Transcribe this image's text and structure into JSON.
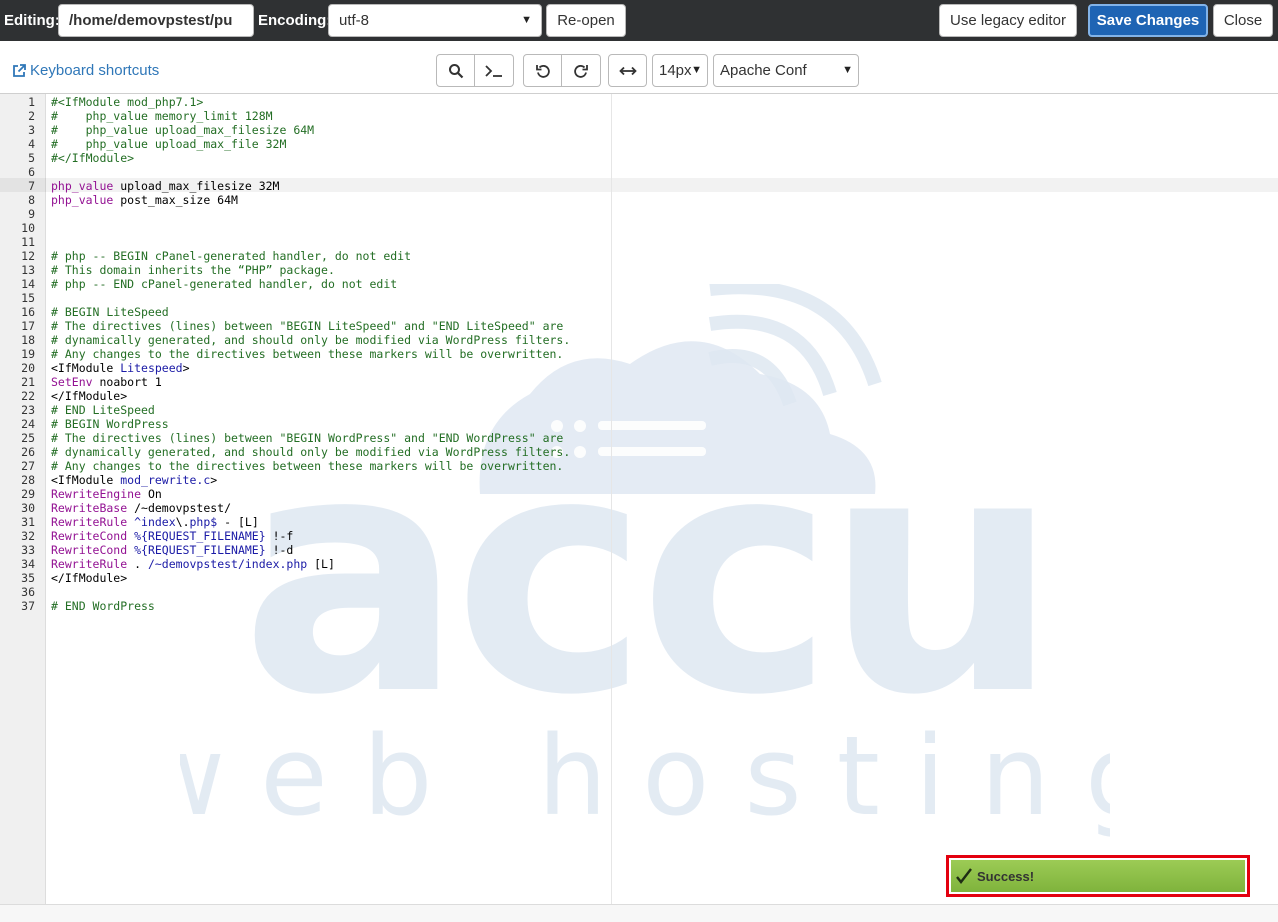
{
  "topbar": {
    "editing_label": "Editing:",
    "file_path": "/home/demovpstest/pu",
    "encoding_label": "Encoding:",
    "encoding_value": "utf-8",
    "reopen_label": "Re-open",
    "legacy_label": "Use legacy editor",
    "save_label": "Save Changes",
    "close_label": "Close"
  },
  "toolbar": {
    "shortcuts_label": "Keyboard shortcuts",
    "font_size": "14px",
    "mode": "Apache Conf"
  },
  "editor": {
    "active_line": 7,
    "lines": [
      {
        "n": "1",
        "segs": [
          {
            "t": "#<IfModule mod_php7.1>",
            "c": "c"
          }
        ]
      },
      {
        "n": "2",
        "segs": [
          {
            "t": "#    php_value memory_limit 128M",
            "c": "c"
          }
        ]
      },
      {
        "n": "3",
        "segs": [
          {
            "t": "#    php_value upload_max_filesize 64M",
            "c": "c"
          }
        ]
      },
      {
        "n": "4",
        "segs": [
          {
            "t": "#    php_value upload_max_file 32M",
            "c": "c"
          }
        ]
      },
      {
        "n": "5",
        "segs": [
          {
            "t": "#</IfModule>",
            "c": "c"
          }
        ]
      },
      {
        "n": "6",
        "segs": []
      },
      {
        "n": "7",
        "segs": [
          {
            "t": "php_value",
            "c": "k"
          },
          {
            "t": " upload_max_filesize 32M",
            "c": ""
          }
        ]
      },
      {
        "n": "8",
        "segs": [
          {
            "t": "php_value",
            "c": "k"
          },
          {
            "t": " post_max_size 64M",
            "c": ""
          }
        ]
      },
      {
        "n": "9",
        "segs": []
      },
      {
        "n": "10",
        "segs": []
      },
      {
        "n": "11",
        "segs": []
      },
      {
        "n": "12",
        "segs": [
          {
            "t": "# php -- BEGIN cPanel-generated handler, do not edit",
            "c": "c"
          }
        ]
      },
      {
        "n": "13",
        "segs": [
          {
            "t": "# This domain inherits the “PHP” package.",
            "c": "c"
          }
        ]
      },
      {
        "n": "14",
        "segs": [
          {
            "t": "# php -- END cPanel-generated handler, do not edit",
            "c": "c"
          }
        ]
      },
      {
        "n": "15",
        "segs": []
      },
      {
        "n": "16",
        "segs": [
          {
            "t": "# BEGIN LiteSpeed",
            "c": "c"
          }
        ]
      },
      {
        "n": "17",
        "segs": [
          {
            "t": "# The directives (lines) between \"BEGIN LiteSpeed\" and \"END LiteSpeed\" are",
            "c": "c"
          }
        ]
      },
      {
        "n": "18",
        "segs": [
          {
            "t": "# dynamically generated, and should only be modified via WordPress filters.",
            "c": "c"
          }
        ]
      },
      {
        "n": "19",
        "segs": [
          {
            "t": "# Any changes to the directives between these markers will be overwritten.",
            "c": "c"
          }
        ]
      },
      {
        "n": "20",
        "segs": [
          {
            "t": "<IfModule ",
            "c": ""
          },
          {
            "t": "Litespeed",
            "c": "v"
          },
          {
            "t": ">",
            "c": ""
          }
        ]
      },
      {
        "n": "21",
        "segs": [
          {
            "t": "SetEnv",
            "c": "k"
          },
          {
            "t": " noabort 1",
            "c": ""
          }
        ]
      },
      {
        "n": "22",
        "segs": [
          {
            "t": "</IfModule>",
            "c": ""
          }
        ]
      },
      {
        "n": "23",
        "segs": [
          {
            "t": "# END LiteSpeed",
            "c": "c"
          }
        ]
      },
      {
        "n": "24",
        "segs": [
          {
            "t": "# BEGIN WordPress",
            "c": "c"
          }
        ]
      },
      {
        "n": "25",
        "segs": [
          {
            "t": "# The directives (lines) between \"BEGIN WordPress\" and \"END WordPress\" are",
            "c": "c"
          }
        ]
      },
      {
        "n": "26",
        "segs": [
          {
            "t": "# dynamically generated, and should only be modified via WordPress filters.",
            "c": "c"
          }
        ]
      },
      {
        "n": "27",
        "segs": [
          {
            "t": "# Any changes to the directives between these markers will be overwritten.",
            "c": "c"
          }
        ]
      },
      {
        "n": "28",
        "segs": [
          {
            "t": "<IfModule ",
            "c": ""
          },
          {
            "t": "mod_rewrite.c",
            "c": "v"
          },
          {
            "t": ">",
            "c": ""
          }
        ]
      },
      {
        "n": "29",
        "segs": [
          {
            "t": "RewriteEngine",
            "c": "k"
          },
          {
            "t": " On",
            "c": ""
          }
        ]
      },
      {
        "n": "30",
        "segs": [
          {
            "t": "RewriteBase",
            "c": "k"
          },
          {
            "t": " /~demovpstest/",
            "c": ""
          }
        ]
      },
      {
        "n": "31",
        "segs": [
          {
            "t": "RewriteRule",
            "c": "k"
          },
          {
            "t": " ^index",
            "c": "v"
          },
          {
            "t": "\\.",
            "c": ""
          },
          {
            "t": "php$",
            "c": "v"
          },
          {
            "t": " - [L]",
            "c": ""
          }
        ]
      },
      {
        "n": "32",
        "segs": [
          {
            "t": "RewriteCond",
            "c": "k"
          },
          {
            "t": " %{REQUEST_FILENAME}",
            "c": "v"
          },
          {
            "t": " !-f",
            "c": ""
          }
        ]
      },
      {
        "n": "33",
        "segs": [
          {
            "t": "RewriteCond",
            "c": "k"
          },
          {
            "t": " %{REQUEST_FILENAME}",
            "c": "v"
          },
          {
            "t": " !-d",
            "c": ""
          }
        ]
      },
      {
        "n": "34",
        "segs": [
          {
            "t": "RewriteRule",
            "c": "k"
          },
          {
            "t": " . ",
            "c": ""
          },
          {
            "t": "/~demovpstest/index.php",
            "c": "v"
          },
          {
            "t": " [L]",
            "c": ""
          }
        ]
      },
      {
        "n": "35",
        "segs": [
          {
            "t": "</IfModule>",
            "c": ""
          }
        ]
      },
      {
        "n": "36",
        "segs": []
      },
      {
        "n": "37",
        "segs": [
          {
            "t": "# END WordPress",
            "c": "c"
          }
        ]
      }
    ]
  },
  "watermark": {
    "brand": "accu",
    "tagline": "w e b   h o s t i n g"
  },
  "toast": {
    "message": "Success!"
  },
  "colors": {
    "topbar_bg": "#2f3133",
    "primary_button": "#1e64b4",
    "comment": "#236e24",
    "keyword": "#931293",
    "variable": "#1a1aa6",
    "toast_green": "#8bbf47",
    "highlight_red": "#e3000f",
    "link": "#2f77b8"
  }
}
